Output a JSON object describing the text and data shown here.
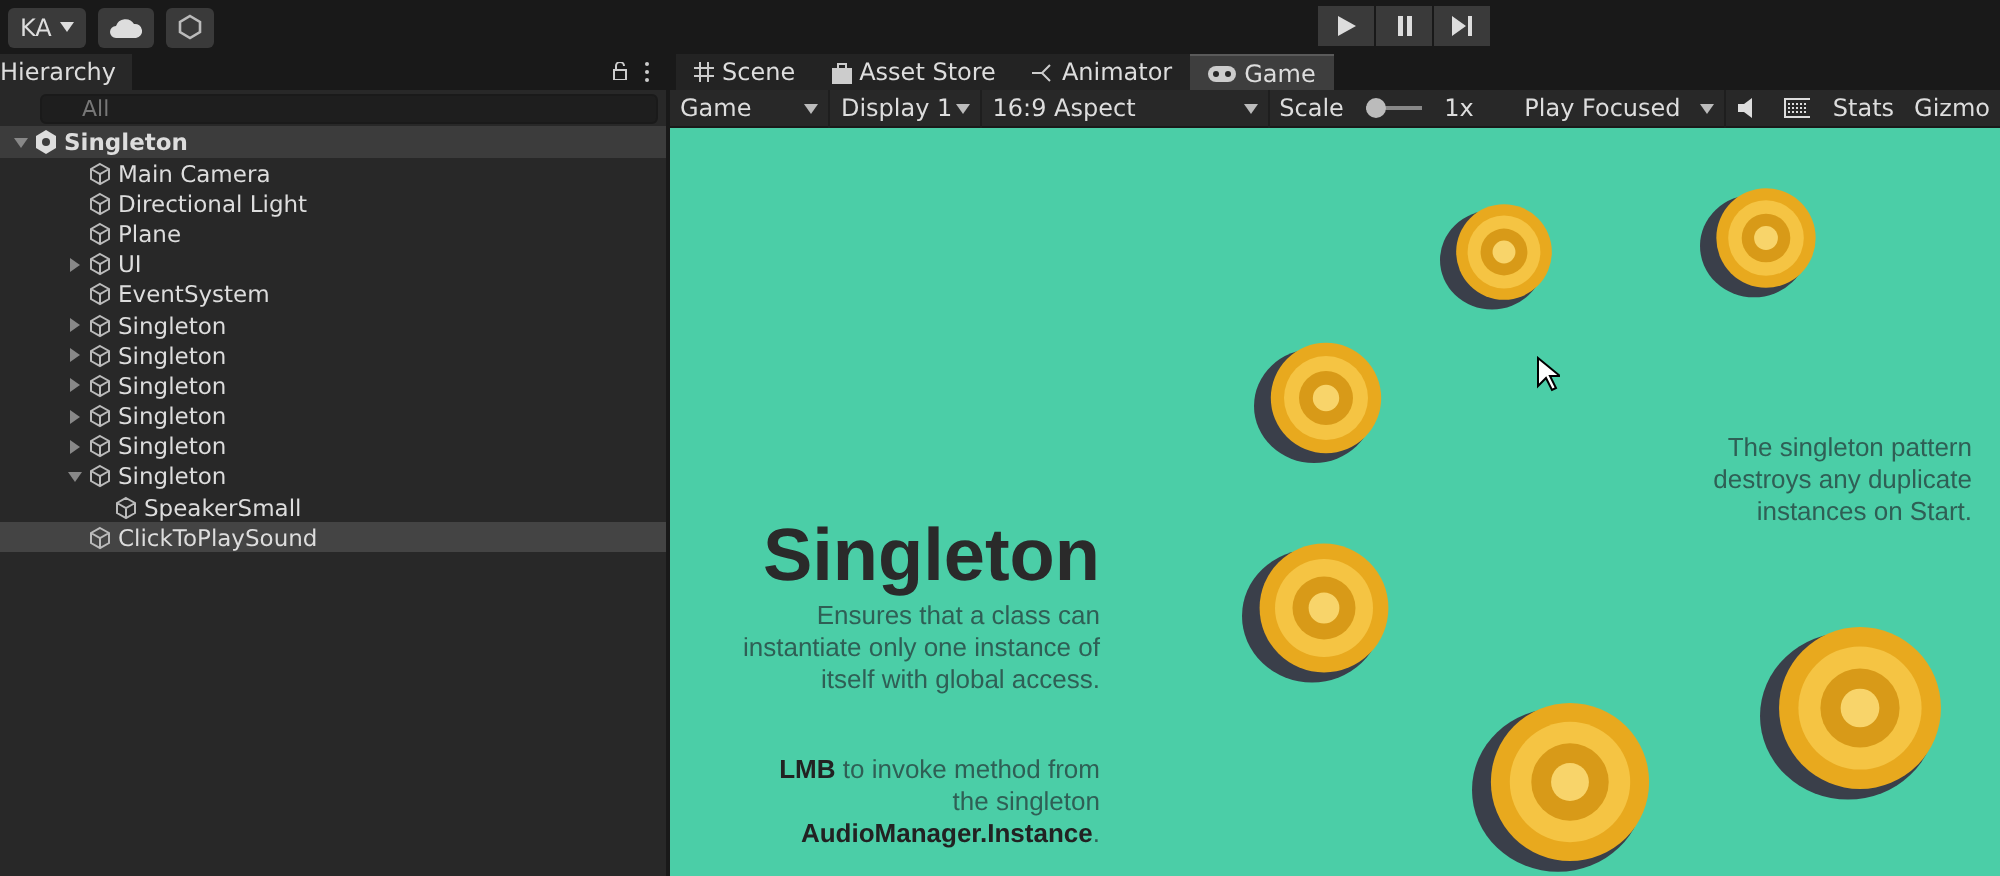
{
  "toolbar": {
    "account": "KA",
    "play_controls": [
      {
        "kind": "play",
        "selected": false
      },
      {
        "kind": "pause",
        "selected": false
      },
      {
        "kind": "step",
        "selected": false
      }
    ]
  },
  "hierarchy": {
    "title": "Hierarchy",
    "search": {
      "placeholder": "All"
    },
    "scene": {
      "label": "Singleton",
      "expanded": true,
      "children": [
        {
          "label": "Main Camera",
          "selected": false
        },
        {
          "label": "Directional Light",
          "selected": false
        },
        {
          "label": "Plane",
          "selected": false
        },
        {
          "label": "UI",
          "selected": false,
          "expanded": false
        },
        {
          "label": "EventSystem",
          "selected": false
        },
        {
          "label": "Singleton",
          "selected": false,
          "expanded": false
        },
        {
          "label": "Singleton",
          "selected": false,
          "expanded": false
        },
        {
          "label": "Singleton",
          "selected": false,
          "expanded": false
        },
        {
          "label": "Singleton",
          "selected": false,
          "expanded": false
        },
        {
          "label": "Singleton",
          "selected": false,
          "expanded": false
        },
        {
          "label": "Singleton",
          "selected": false,
          "expanded": true,
          "children": [
            {
              "label": "SpeakerSmall",
              "selected": false
            }
          ]
        },
        {
          "label": "ClickToPlaySound",
          "selected": true
        }
      ]
    }
  },
  "view_tabs": [
    {
      "label": "Scene",
      "kind": "scene",
      "selected": false
    },
    {
      "label": "Asset Store",
      "kind": "store",
      "selected": false
    },
    {
      "label": "Animator",
      "kind": "animator",
      "selected": false
    },
    {
      "label": "Game",
      "kind": "game",
      "selected": true
    }
  ],
  "game_toolbar": {
    "view": "Game",
    "display": "Display 1",
    "aspect": "16:9 Aspect",
    "scale_label": "Scale",
    "scale": {
      "level": 0
    },
    "scale_value": "1x",
    "play_mode": "Play Focused",
    "stats": "Stats",
    "gizmos": "Gizmo"
  },
  "game_view": {
    "title": "Singleton",
    "description": "Ensures that a class can instantiate only one instance of itself with global access.",
    "hint": "**LMB** to invoke method from the singleton **AudioManager.Instance**.",
    "note": "The singleton pattern destroys any duplicate instances on Start."
  }
}
